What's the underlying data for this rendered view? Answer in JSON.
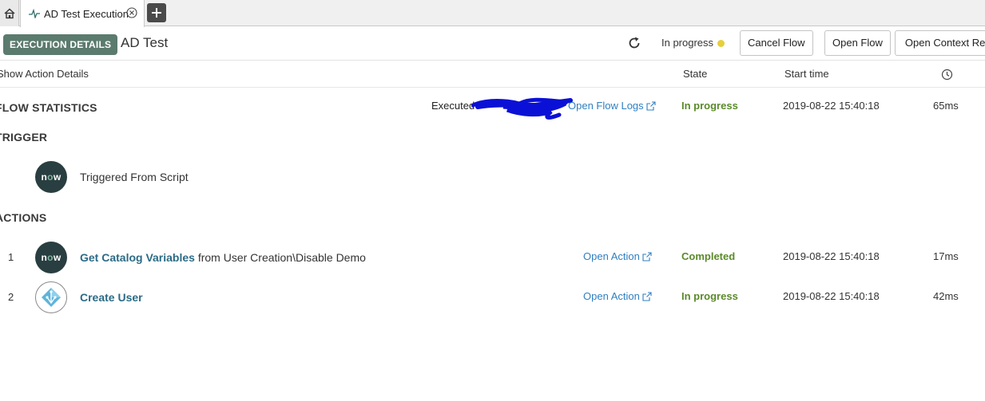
{
  "tabs": {
    "active_label": "AD Test Execution"
  },
  "header": {
    "badge": "EXECUTION DETAILS",
    "flow_name": "AD Test",
    "status": "In progress",
    "status_color": "#e5cf3a",
    "buttons": {
      "cancel": "Cancel Flow",
      "open_flow": "Open Flow",
      "open_context": "Open Context Reco"
    }
  },
  "columns": {
    "show_details": "Show Action Details",
    "state": "State",
    "start_time": "Start time"
  },
  "flow_statistics": {
    "title": "FLOW STATISTICS",
    "executed_label": "Executed",
    "logs_link": "Open Flow Logs",
    "state": "In progress",
    "start_time": "2019-08-22 15:40:18",
    "duration": "65ms"
  },
  "trigger": {
    "title": "TRIGGER",
    "logo_text_a": "n",
    "logo_text_b": "o",
    "logo_text_c": "w",
    "label": "Triggered From Script"
  },
  "actions": {
    "title": "ACTIONS",
    "items": [
      {
        "num": "1",
        "name": "Get Catalog Variables",
        "suffix": " from User Creation\\Disable Demo",
        "link": "Open Action",
        "state": "Completed",
        "start_time": "2019-08-22 15:40:18",
        "duration": "17ms"
      },
      {
        "num": "2",
        "name": "Create User",
        "suffix": "",
        "link": "Open Action",
        "state": "In progress",
        "start_time": "2019-08-22 15:40:18",
        "duration": "42ms"
      }
    ]
  },
  "colors": {
    "badge_bg": "#5b7b6e",
    "link": "#2f7fc1",
    "state_green": "#5a8a2a",
    "now_bg": "#293e40"
  }
}
